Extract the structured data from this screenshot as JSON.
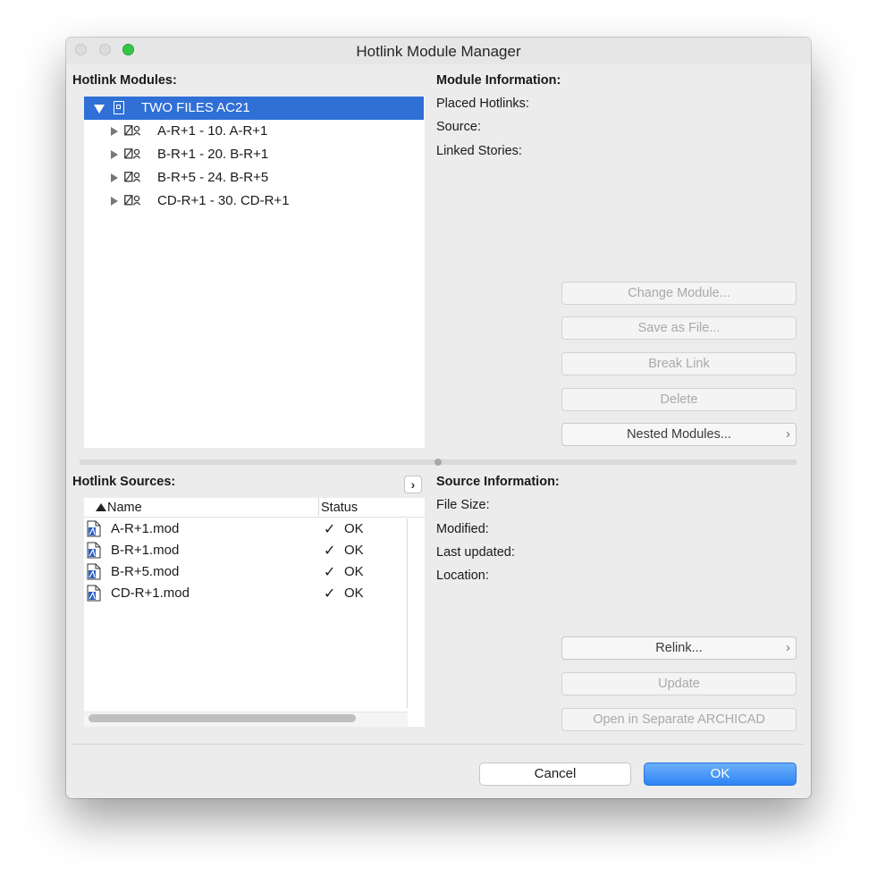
{
  "window": {
    "title": "Hotlink Module Manager"
  },
  "modules": {
    "heading": "Hotlink Modules:",
    "root": {
      "label": "TWO FILES AC21"
    },
    "items": [
      {
        "label": "A-R+1 - 10. A-R+1"
      },
      {
        "label": "B-R+1 - 20. B-R+1"
      },
      {
        "label": "B-R+5 - 24. B-R+5"
      },
      {
        "label": "CD-R+1 - 30. CD-R+1"
      }
    ]
  },
  "module_info": {
    "heading": "Module Information:",
    "placed": "Placed Hotlinks:",
    "source": "Source:",
    "linked": "Linked Stories:",
    "buttons": {
      "change": "Change Module...",
      "save": "Save as File...",
      "break": "Break Link",
      "delete": "Delete",
      "nested": "Nested Modules..."
    }
  },
  "sources": {
    "heading": "Hotlink Sources:",
    "expand_glyph": "›",
    "columns": {
      "name": "Name",
      "status": "Status"
    },
    "rows": [
      {
        "name": "A-R+1.mod",
        "check": "✓",
        "status": "OK"
      },
      {
        "name": "B-R+1.mod",
        "check": "✓",
        "status": "OK"
      },
      {
        "name": "B-R+5.mod",
        "check": "✓",
        "status": "OK"
      },
      {
        "name": "CD-R+1.mod",
        "check": "✓",
        "status": "OK"
      }
    ]
  },
  "source_info": {
    "heading": "Source Information:",
    "size": "File Size:",
    "modified": "Modified:",
    "updated": "Last updated:",
    "location": "Location:",
    "buttons": {
      "relink": "Relink...",
      "update": "Update",
      "open": "Open in Separate ARCHICAD"
    }
  },
  "footer": {
    "cancel": "Cancel",
    "ok": "OK"
  },
  "colors": {
    "selection": "#2f6fd6",
    "ok_button": "#2f84f5",
    "zoom_light": "#35c648"
  }
}
